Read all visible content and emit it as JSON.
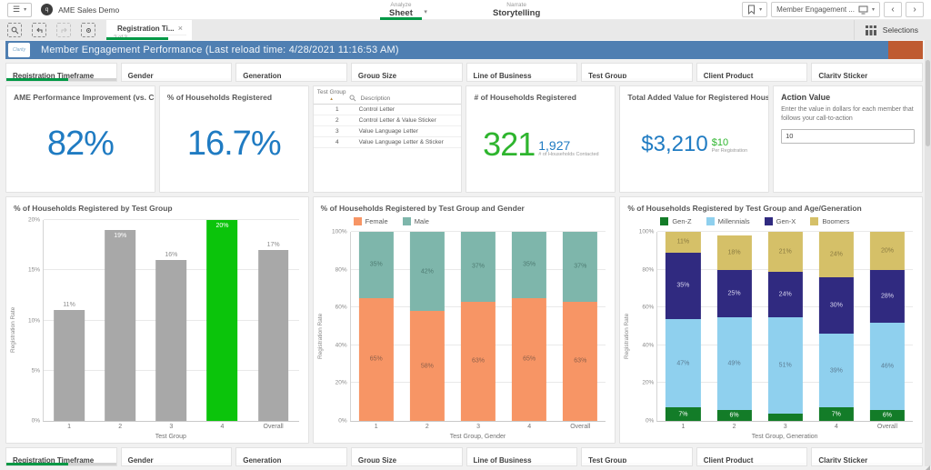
{
  "topbar": {
    "menu_icon_glyph": "☰",
    "caret_glyph": "▾",
    "app_title": "AME Sales Demo",
    "analyze": {
      "label": "Analyze",
      "value": "Sheet"
    },
    "narrate": {
      "label": "Narrate",
      "value": "Storytelling"
    },
    "sheet_selector_label": "Member Engagement ...",
    "prev_glyph": "‹",
    "next_glyph": "›"
  },
  "tabbar": {
    "tab": {
      "title": "Registration Ti...",
      "subtitle": "2 of 3",
      "close_glyph": "×"
    },
    "selections_label": "Selections"
  },
  "header": {
    "logo_text": "Clarity",
    "title": "Member Engagement Performance (Last reload time: 4/28/2021 11:16:53 AM)"
  },
  "filters": [
    "Registration Timeframe",
    "Gender",
    "Generation",
    "Group Size",
    "Line of Business",
    "Test Group",
    "Client Product",
    "Clarity Sticker"
  ],
  "kpis": {
    "performance": {
      "title": "AME Performance Improvement (vs. C...",
      "value": "82%"
    },
    "pct_registered": {
      "title": "% of Households Registered",
      "value": "16.7%"
    },
    "test_groups": {
      "col1": "Test Group",
      "col2": "Description",
      "sort_glyph": "▲",
      "rows": [
        [
          "1",
          "Control Letter"
        ],
        [
          "2",
          "Control Letter & Value Sticker"
        ],
        [
          "3",
          "Value Language Letter"
        ],
        [
          "4",
          "Value Language Letter & Sticker"
        ]
      ]
    },
    "households_registered": {
      "title": "# of Households Registered",
      "value": "321",
      "secondary_value": "1,927",
      "secondary_label": "# of Households Contacted"
    },
    "added_value": {
      "title": "Total Added Value for Registered Hous...",
      "value": "$3,210",
      "secondary_value": "$10",
      "secondary_label": "Per Registration"
    },
    "action_value": {
      "title": "Action Value",
      "description": "Enter the value in dollars for each member that follows your call-to-action",
      "input_value": "10"
    }
  },
  "chart_data": [
    {
      "type": "bar",
      "title": "% of Households Registered by Test Group",
      "xlabel": "Test Group",
      "ylabel": "Registration Rate",
      "categories": [
        "1",
        "2",
        "3",
        "4",
        "Overall"
      ],
      "values": [
        11,
        19,
        16,
        20,
        17
      ],
      "bar_colors": [
        "#a8a8a8",
        "#a8a8a8",
        "#a8a8a8",
        "#0bc40b",
        "#a8a8a8"
      ],
      "ylim": [
        0,
        20
      ],
      "yticks": [
        0,
        5,
        10,
        15,
        20
      ],
      "grid": true,
      "legend_position": "none"
    },
    {
      "type": "stacked-bar",
      "title": "% of Households Registered by Test Group and Gender",
      "xlabel": "Test Group, Gender",
      "ylabel": "Registration Rate",
      "categories": [
        "1",
        "2",
        "3",
        "4",
        "Overall"
      ],
      "ylim": [
        0,
        100
      ],
      "yticks": [
        0,
        20,
        40,
        60,
        80,
        100
      ],
      "grid": true,
      "legend_position": "top",
      "series": [
        {
          "name": "Female",
          "color": "#f79565",
          "label_color": "#8d5f49",
          "values": [
            65,
            58,
            63,
            65,
            63
          ]
        },
        {
          "name": "Male",
          "color": "#7eb6ab",
          "label_color": "#4e7b72",
          "values": [
            35,
            42,
            37,
            35,
            37
          ]
        }
      ]
    },
    {
      "type": "stacked-bar",
      "title": "% of Households Registered by Test Group and Age/Generation",
      "xlabel": "Test Group, Generation",
      "ylabel": "Registration Rate",
      "categories": [
        "1",
        "2",
        "3",
        "4",
        "Overall"
      ],
      "ylim": [
        0,
        100
      ],
      "yticks": [
        0,
        20,
        40,
        60,
        80,
        100
      ],
      "grid": true,
      "legend_position": "top",
      "series": [
        {
          "name": "Gen-Z",
          "color": "#137c28",
          "label_color": "#ffffff",
          "values": [
            7,
            6,
            4,
            7,
            6
          ]
        },
        {
          "name": "Millennials",
          "color": "#8fd0ee",
          "label_color": "#5b7c93",
          "values": [
            47,
            49,
            51,
            39,
            46
          ]
        },
        {
          "name": "Gen-X",
          "color": "#302a80",
          "label_color": "#d9d7ef",
          "values": [
            35,
            25,
            24,
            30,
            28
          ]
        },
        {
          "name": "Boomers",
          "color": "#d5c068",
          "label_color": "#8a7a40",
          "values": [
            11,
            18,
            21,
            24,
            20
          ]
        }
      ]
    }
  ],
  "colors": {
    "accent_blue": "#1f7bc2",
    "accent_green": "#2eb52e",
    "selection_green": "#009845",
    "header_blue": "#4f7fb2",
    "header_orange": "#bf5b31",
    "bar_gray": "#a8a8a8",
    "bar_selected_green": "#0bc40b"
  }
}
